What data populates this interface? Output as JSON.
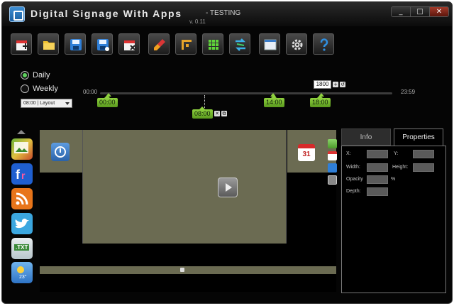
{
  "window": {
    "title": "Digital Signage With Apps",
    "subtitle": "- TESTING",
    "version": "v. 0.11",
    "controls": {
      "minimize": "_",
      "maximize": "□",
      "close": "✕"
    }
  },
  "toolbar": {
    "buttons": [
      {
        "name": "new-layout",
        "icon": "calendar-add-icon"
      },
      {
        "name": "open",
        "icon": "folder-icon"
      },
      {
        "name": "save",
        "icon": "floppy-icon"
      },
      {
        "name": "save-as",
        "icon": "floppy-star-icon"
      },
      {
        "name": "close-layout",
        "icon": "calendar-close-icon"
      },
      {
        "name": "clear",
        "icon": "broom-icon"
      },
      {
        "name": "frame",
        "icon": "frame-icon"
      },
      {
        "name": "grid",
        "icon": "grid-icon"
      },
      {
        "name": "sync",
        "icon": "sync-icon"
      },
      {
        "name": "window",
        "icon": "window-icon"
      },
      {
        "name": "settings",
        "icon": "gear-icon"
      },
      {
        "name": "help",
        "icon": "help-icon"
      }
    ]
  },
  "schedule": {
    "daily_label": "Daily",
    "weekly_label": "Weekly",
    "selected": "Daily",
    "layout_select_value": "08:00 | Layout"
  },
  "timeline": {
    "start_label": "00:00",
    "end_label": "23:59",
    "duration_value": "1800",
    "markers": [
      "00:00",
      "08:00",
      "14:00",
      "18:00"
    ]
  },
  "properties": {
    "tab_info": "Info",
    "tab_properties": "Properties",
    "active_tab": "Properties",
    "x_label": "X:",
    "y_label": "Y:",
    "width_label": "Width:",
    "height_label": "Height:",
    "opacity_label": "Opacity",
    "opacity_unit": "%",
    "depth_label": "Depth:"
  },
  "canvas": {
    "calendar_day": "31"
  },
  "widgets": {
    "txt_label": ".TXT",
    "weather_temp": "23°"
  },
  "colors": {
    "accent_green": "#7bc236",
    "zone_fill": "#6b6b52",
    "window_bg": "#050505"
  }
}
